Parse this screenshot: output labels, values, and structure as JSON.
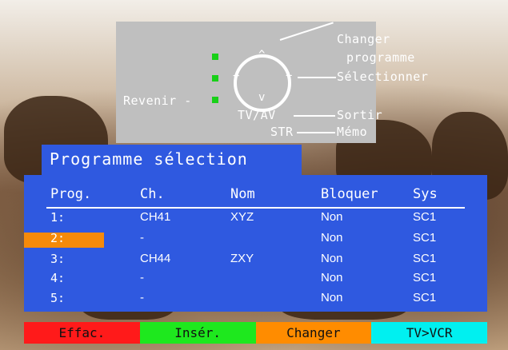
{
  "remote": {
    "changer_programme": [
      "Changer",
      "programme"
    ],
    "selectionner": "Sélectionner",
    "revenir": "Revenir -",
    "tvav": "TV/AV",
    "sortir": "Sortir",
    "str": "STR",
    "memo": "Mémo",
    "arrows": {
      "up": "^",
      "down": "v",
      "left": "−",
      "right": "+"
    }
  },
  "title": "Programme sélection",
  "table": {
    "headers": [
      "Prog.",
      "Ch.",
      "Nom",
      "Bloquer",
      "Sys"
    ],
    "rows": [
      {
        "prog": "1:",
        "ch": "CH41",
        "nom": "XYZ",
        "bloquer": "Non",
        "sys": "SC1"
      },
      {
        "prog": "2:",
        "ch": "-",
        "nom": "",
        "bloquer": "Non",
        "sys": "SC1"
      },
      {
        "prog": "3:",
        "ch": "CH44",
        "nom": "ZXY",
        "bloquer": "Non",
        "sys": "SC1"
      },
      {
        "prog": "4:",
        "ch": "-",
        "nom": "",
        "bloquer": "Non",
        "sys": "SC1"
      },
      {
        "prog": "5:",
        "ch": "-",
        "nom": "",
        "bloquer": "Non",
        "sys": "SC1"
      }
    ],
    "selected_row": 2
  },
  "buttons": [
    {
      "label": "Effac.",
      "color": "#ff1a1a"
    },
    {
      "label": "Insér.",
      "color": "#1ee81e"
    },
    {
      "label": "Changer",
      "color": "#ff8c00"
    },
    {
      "label": "TV>VCR",
      "color": "#00f0f0"
    }
  ]
}
